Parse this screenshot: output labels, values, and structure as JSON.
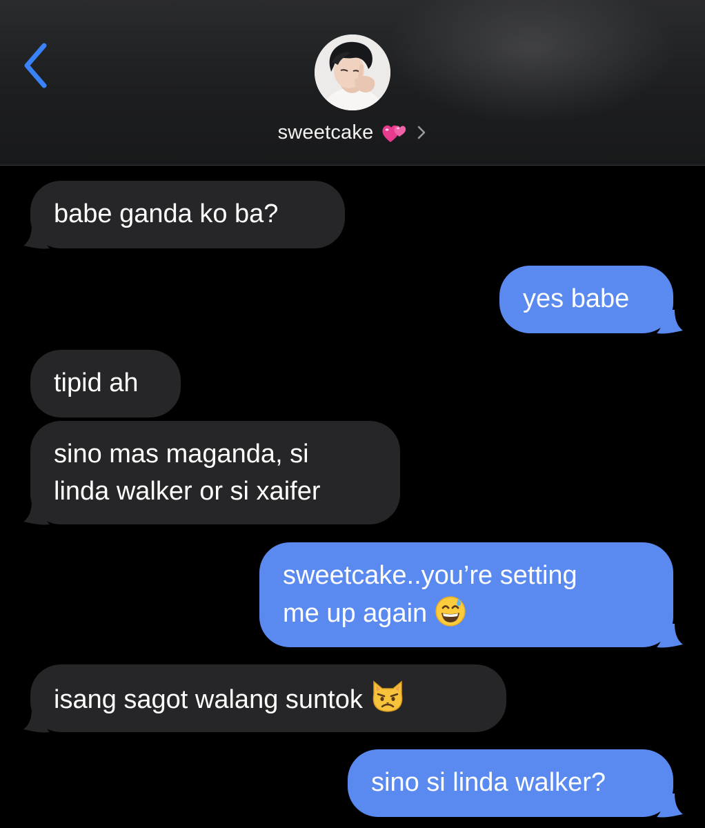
{
  "header": {
    "contact_name": "sweetcake",
    "contact_emoji_icon": "two-hearts-icon",
    "back_icon": "chevron-left-icon",
    "details_icon": "chevron-right-icon"
  },
  "colors": {
    "incoming_bubble": "#262628",
    "outgoing_bubble": "#5a8af0",
    "accent": "#3a82f7",
    "background": "#000000"
  },
  "messages": [
    {
      "from": "them",
      "text": "babe ganda ko ba?"
    },
    {
      "from": "me",
      "text": "yes babe"
    },
    {
      "from": "them",
      "text": "tipid ah"
    },
    {
      "from": "them",
      "lines": [
        "sino mas maganda, si",
        "linda walker or si xaifer"
      ]
    },
    {
      "from": "me",
      "lines": [
        "sweetcake..you’re setting",
        "me up again"
      ],
      "emoji": "grinning-sweat-emoji"
    },
    {
      "from": "them",
      "text": "isang sagot walang suntok",
      "emoji": "pouting-cat-emoji"
    },
    {
      "from": "me",
      "text": "sino si linda walker?"
    }
  ]
}
